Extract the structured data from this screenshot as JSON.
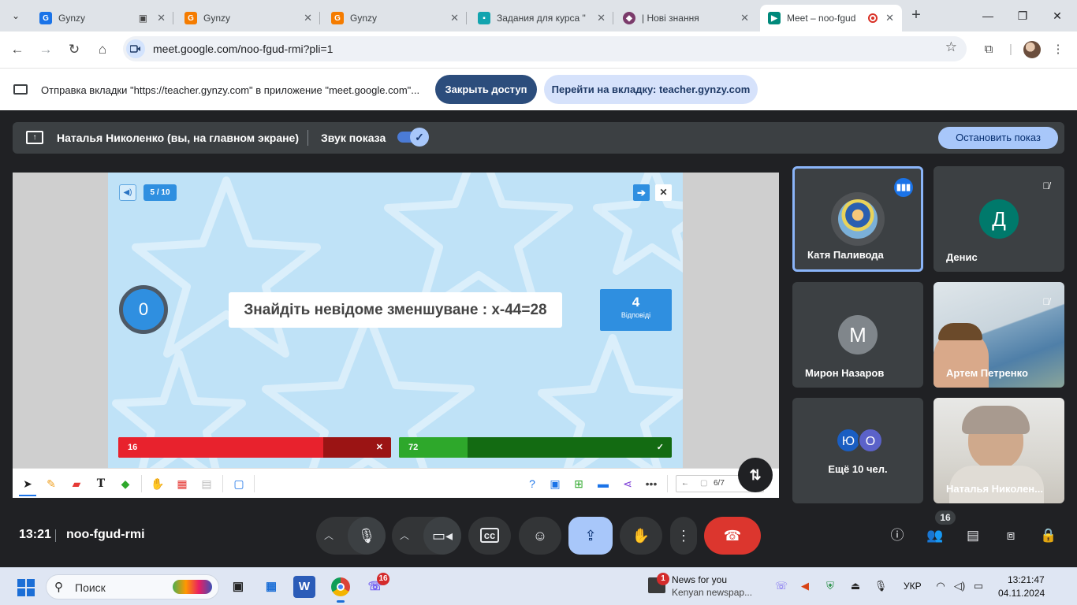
{
  "browser": {
    "tabs": [
      {
        "title": "Gynzy",
        "favicon": "G",
        "favicon_color": "#1a73e8",
        "extra": "screen-share-icon"
      },
      {
        "title": "Gynzy",
        "favicon": "G",
        "favicon_color": "#f57c00"
      },
      {
        "title": "Gynzy",
        "favicon": "G",
        "favicon_color": "#f57c00"
      },
      {
        "title": "Задания для курса \"",
        "favicon": "",
        "favicon_color": "#12a4af"
      },
      {
        "title": "| Нові знання",
        "favicon": "",
        "favicon_color": "#7b3b6b"
      },
      {
        "title": "Meet – noo-fgud",
        "favicon": "",
        "favicon_color": "#00897b",
        "active": true,
        "extra": "recording-icon"
      }
    ],
    "url": "meet.google.com/noo-fgud-rmi?pli=1"
  },
  "infobar": {
    "text": "Отправка вкладки \"https://teacher.gynzy.com\" в приложение \"meet.google.com\"...",
    "stop_access": "Закрыть доступ",
    "goto_tab": "Перейти на вкладку: teacher.gynzy.com"
  },
  "presenting": {
    "name": "Наталья Николенко (вы, на главном экране)",
    "sound_label": "Звук показа",
    "sound_on": true,
    "stop_button": "Остановить показ"
  },
  "slide": {
    "counter": "5 / 10",
    "score": "0",
    "question": "Знайдіть невідоме зменшуване : х-44=28",
    "answers_count": "4",
    "answers_label": "Відповіді",
    "wrong_value": "16",
    "right_value": "72",
    "wrong_mark": "✕",
    "right_mark": "✓",
    "wrong_fraction": 0.75,
    "right_fraction": 0.25,
    "page_indicator": "6/7"
  },
  "participants": [
    {
      "name": "Катя Паливода",
      "speaking": true
    },
    {
      "name": "Денис",
      "initial": "Д",
      "avatar_color": "#00796b",
      "muted": true
    },
    {
      "name": "Мирон Назаров",
      "initial": "М",
      "avatar_color": "#80868b"
    },
    {
      "name": "Артем Петренко",
      "muted": true
    },
    {
      "name": "Ещё 10 чел.",
      "initials": [
        "Ю",
        "О"
      ],
      "initials_colors": [
        "#1a5ec2",
        "#5b62c9"
      ]
    },
    {
      "name": "Наталья Николен..."
    }
  ],
  "meet_bar": {
    "time": "13:21",
    "code": "noo-fgud-rmi",
    "people_count": "16"
  },
  "taskbar": {
    "search_placeholder": "Поиск",
    "viber_badge": "16",
    "news_badge": "1",
    "news_title": "News for you",
    "news_subtitle": "Kenyan newspap...",
    "language": "УКР",
    "time": "13:21:47",
    "date": "04.11.2024"
  }
}
